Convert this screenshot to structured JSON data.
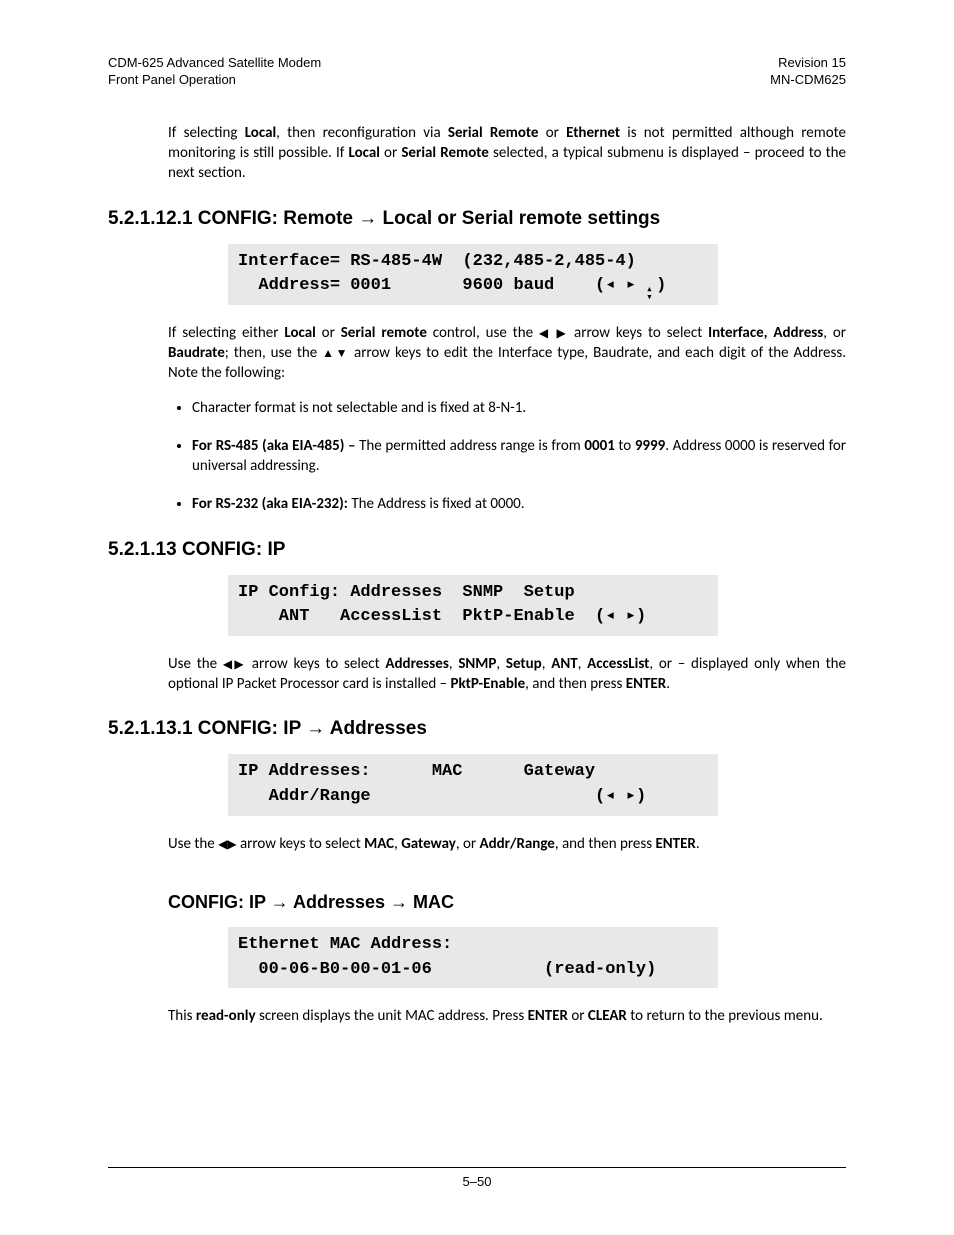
{
  "header": {
    "left1": "CDM-625 Advanced Satellite Modem",
    "left2": "Front Panel Operation",
    "right1": "Revision 15",
    "right2": "MN-CDM625"
  },
  "intro_para_html": "If selecting <b>Local</b>, then reconfiguration via <b>Serial Remote</b> or <b>Ethernet</b> is not permitted although remote monitoring is still possible. If <b>Local</b> or <b>Serial Remote</b> selected, a typical submenu is displayed – proceed to the next section.",
  "sec1": {
    "heading": "5.2.1.12.1  CONFIG: Remote → Local or Serial remote settings",
    "lcd": "Interface= RS-485-4W  (232,485-2,485-4)\n  Address= 0001       9600 baud    (◂ ▸ ◂▸)",
    "lcd_line1": "Interface= RS-485-4W  (232,485-2,485-4)",
    "lcd_line2a": "  Address= 0001       9600 baud    (",
    "lcd_line2b": ")",
    "para_html": "If selecting either <b>Local</b> or <b>Serial remote</b> control, use the <span class='tri'>◀ ▶</span> arrow keys to select <b>Interface, Address</b>, or <b>Baudrate</b>; then, use the <span class='tri'>▲▼</span> arrow keys to edit the Interface type, Baudrate, and each digit of the Address. Note the following:",
    "bullets": [
      "Character format is not selectable and is fixed at 8-N-1.",
      "<b>For RS-485 (aka EIA-485) –</b> The permitted address range is from <b>0001</b> to <b>9999</b>. Address 0000 is reserved for universal addressing.",
      "<b>For RS-232 (aka EIA-232):</b> The Address is fixed at 0000."
    ]
  },
  "sec2": {
    "heading": "5.2.1.13  CONFIG: IP",
    "lcd_line1": "IP Config: Addresses  SNMP  Setup",
    "lcd_line2a": "    ANT   AccessList  PktP-Enable  (",
    "lcd_line2b": ")",
    "para_html": "Use the <span class='tri'>◀▶</span> arrow keys to select <b>Addresses</b>, <b>SNMP</b>, <b>Setup</b>, <b>ANT</b>, <b>AccessList</b>, or – displayed only when the optional IP Packet Processor card is installed – <b>PktP-Enable</b>, and then press <b>ENTER</b>."
  },
  "sec3": {
    "heading": "5.2.1.13.1  CONFIG: IP → Addresses",
    "lcd_line1": "IP Addresses:      MAC      Gateway",
    "lcd_line2a": "   Addr/Range                      (",
    "lcd_line2b": ")",
    "para_html": "Use the <span class='tri'>◀▶</span> arrow keys to select <b>MAC</b>, <b>Gateway</b>, or <b>Addr/Range</b>, and then press <b>ENTER</b>."
  },
  "sec4": {
    "heading": "CONFIG: IP → Addresses → MAC",
    "lcd_line1": "Ethernet MAC Address:",
    "lcd_line2": "  00-06-B0-00-01-06           (read-only)",
    "para_html": "This <b>read-only</b> screen displays the unit MAC address. Press <b>ENTER</b> or <b>CLEAR</b> to return to the previous menu."
  },
  "footer": "5–50",
  "arrows": {
    "left": "◂",
    "right": "▸",
    "updown": "↕"
  }
}
